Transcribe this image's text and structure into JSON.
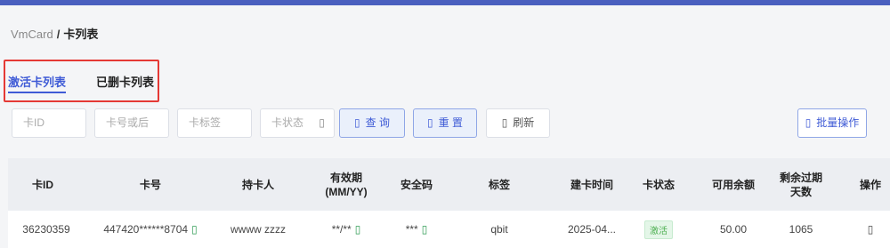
{
  "breadcrumb": {
    "root": "VmCard",
    "separator": "/",
    "current": "卡列表"
  },
  "tabs": [
    {
      "label": "激活卡列表",
      "active": true
    },
    {
      "label": "已删卡列表",
      "active": false
    }
  ],
  "filters": {
    "card_id_placeholder": "卡ID",
    "card_no_placeholder": "卡号或后",
    "tag_placeholder": "卡标签",
    "status_placeholder": "卡状态",
    "status_caret": "▯"
  },
  "buttons": {
    "query": {
      "icon": "▯",
      "label": "查 询",
      "icon_name": "search-icon"
    },
    "reset": {
      "icon": "▯",
      "label": "重 置",
      "icon_name": "refresh-icon"
    },
    "refresh": {
      "icon": "▯",
      "label": "刷新",
      "icon_name": "reload-icon"
    },
    "batch": {
      "icon": "▯",
      "label": "批量操作",
      "icon_name": "batch-icon"
    }
  },
  "table": {
    "headers": [
      "卡ID",
      "卡号",
      "持卡人",
      "有效期 (MM/YY)",
      "安全码",
      "标签",
      "建卡时间",
      "卡状态",
      "可用余额",
      "剩余过期天数",
      "操作"
    ],
    "rows": [
      {
        "card_id": "36230359",
        "card_no": "447420******8704",
        "card_no_icon": "▯",
        "holder": "wwww zzzz",
        "expiry": "**/**",
        "expiry_icon": "▯",
        "cvv": "***",
        "cvv_icon": "▯",
        "tag": "qbit",
        "created": "2025-04...",
        "status": "激活",
        "balance": "50.00",
        "days_left": "1065",
        "action_icon": "▯"
      }
    ]
  },
  "colors": {
    "accent": "#3f5bd6",
    "topbar": "#4a5fbf",
    "highlight_box": "#e53935",
    "status_green": "#4caf50"
  }
}
